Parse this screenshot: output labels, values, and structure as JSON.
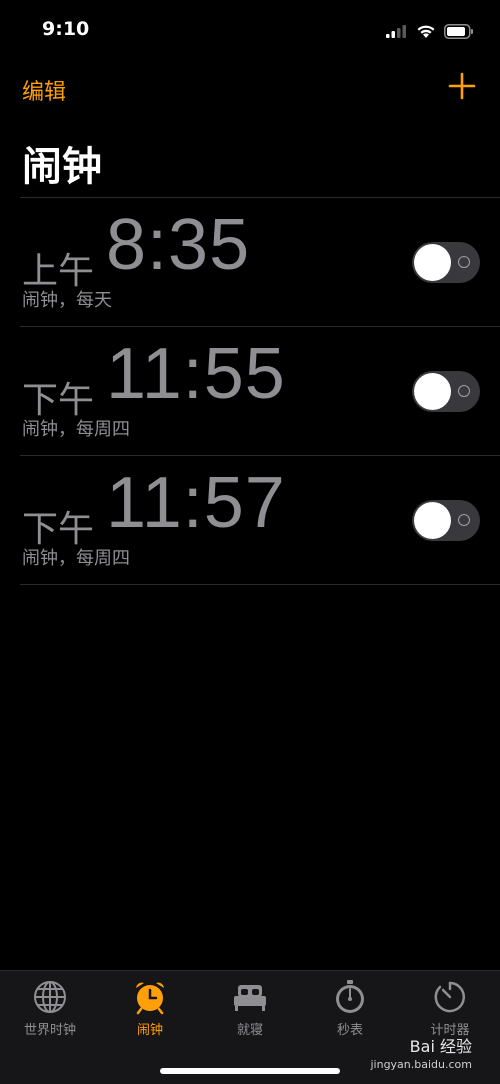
{
  "status_bar": {
    "time": "9:10"
  },
  "nav": {
    "edit_label": "编辑",
    "add_icon": "plus-icon",
    "accent_color": "#ff9f0a"
  },
  "page_title": "闹钟",
  "alarms": [
    {
      "period": "上午",
      "time": "8:35",
      "label": "闹钟，每天",
      "enabled": false
    },
    {
      "period": "下午",
      "time": "11:55",
      "label": "闹钟，每周四",
      "enabled": false
    },
    {
      "period": "下午",
      "time": "11:57",
      "label": "闹钟，每周四",
      "enabled": false
    }
  ],
  "tab_bar": {
    "tabs": [
      {
        "label": "世界时钟",
        "icon": "globe-icon",
        "active": false
      },
      {
        "label": "闹钟",
        "icon": "alarm-clock-icon",
        "active": true
      },
      {
        "label": "就寝",
        "icon": "bed-icon",
        "active": false
      },
      {
        "label": "秒表",
        "icon": "stopwatch-icon",
        "active": false
      },
      {
        "label": "计时器",
        "icon": "timer-icon",
        "active": false
      }
    ]
  },
  "watermark": {
    "brand": "Bai 经验",
    "url": "jingyan.baidu.com"
  }
}
